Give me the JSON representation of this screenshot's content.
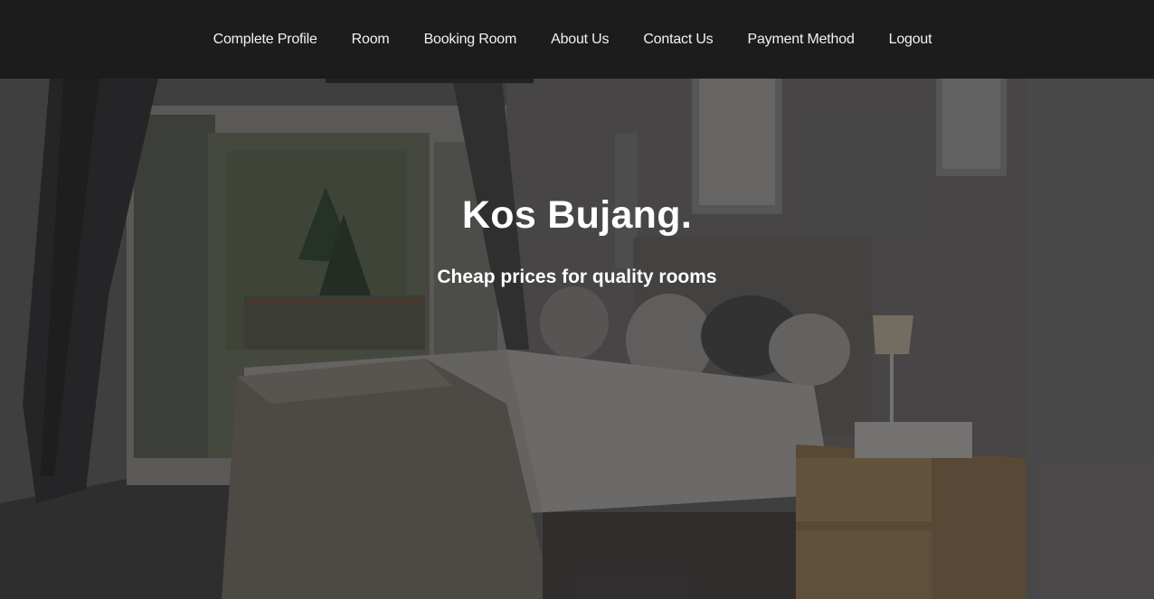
{
  "nav": {
    "items": [
      {
        "label": "Complete Profile"
      },
      {
        "label": "Room"
      },
      {
        "label": "Booking Room"
      },
      {
        "label": "About Us"
      },
      {
        "label": "Contact Us"
      },
      {
        "label": "Payment Method"
      },
      {
        "label": "Logout"
      }
    ]
  },
  "hero": {
    "title": "Kos Bujang.",
    "subtitle": "Cheap prices for quality rooms"
  },
  "colors": {
    "navbar_bg": "#1c1c1c",
    "nav_text": "#f2f2f2",
    "hero_text": "#ffffff"
  }
}
